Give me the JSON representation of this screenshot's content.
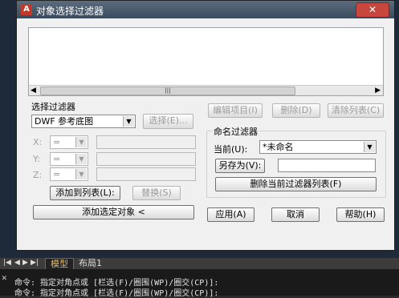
{
  "dialog": {
    "title": "对象选择过滤器",
    "close_glyph": "✕",
    "logo": "A"
  },
  "selection_filter": {
    "label": "选择过滤器",
    "type_value": "DWF 参考底图",
    "select_button": "选择(E)...",
    "x_label": "X:",
    "y_label": "Y:",
    "z_label": "Z:",
    "op_value": "=",
    "add_to_list_button": "添加到列表(L):",
    "replace_button": "替换(S)",
    "add_selected_button": "添加选定对象 <"
  },
  "list_actions": {
    "edit_button": "编辑项目(I)",
    "delete_button": "删除(D)",
    "clear_button": "清除列表(C)"
  },
  "named_filters": {
    "label": "命名过滤器",
    "current_label": "当前(U):",
    "current_value": "*未命名",
    "save_as_button": "另存为(V):",
    "save_as_value": "",
    "delete_button": "删除当前过滤器列表(F)"
  },
  "footer": {
    "apply": "应用(A)",
    "cancel": "取消",
    "help": "帮助(H)"
  },
  "layout_tabs": {
    "model": "模型",
    "layout1": "布局1"
  },
  "command_line": {
    "line1": "命令: 指定对角点或 [栏选(F)/圈围(WP)/圈交(CP)]:",
    "line2": "命令: 指定对角点或 [栏选(F)/圈围(WP)/圈交(CP)]:"
  }
}
